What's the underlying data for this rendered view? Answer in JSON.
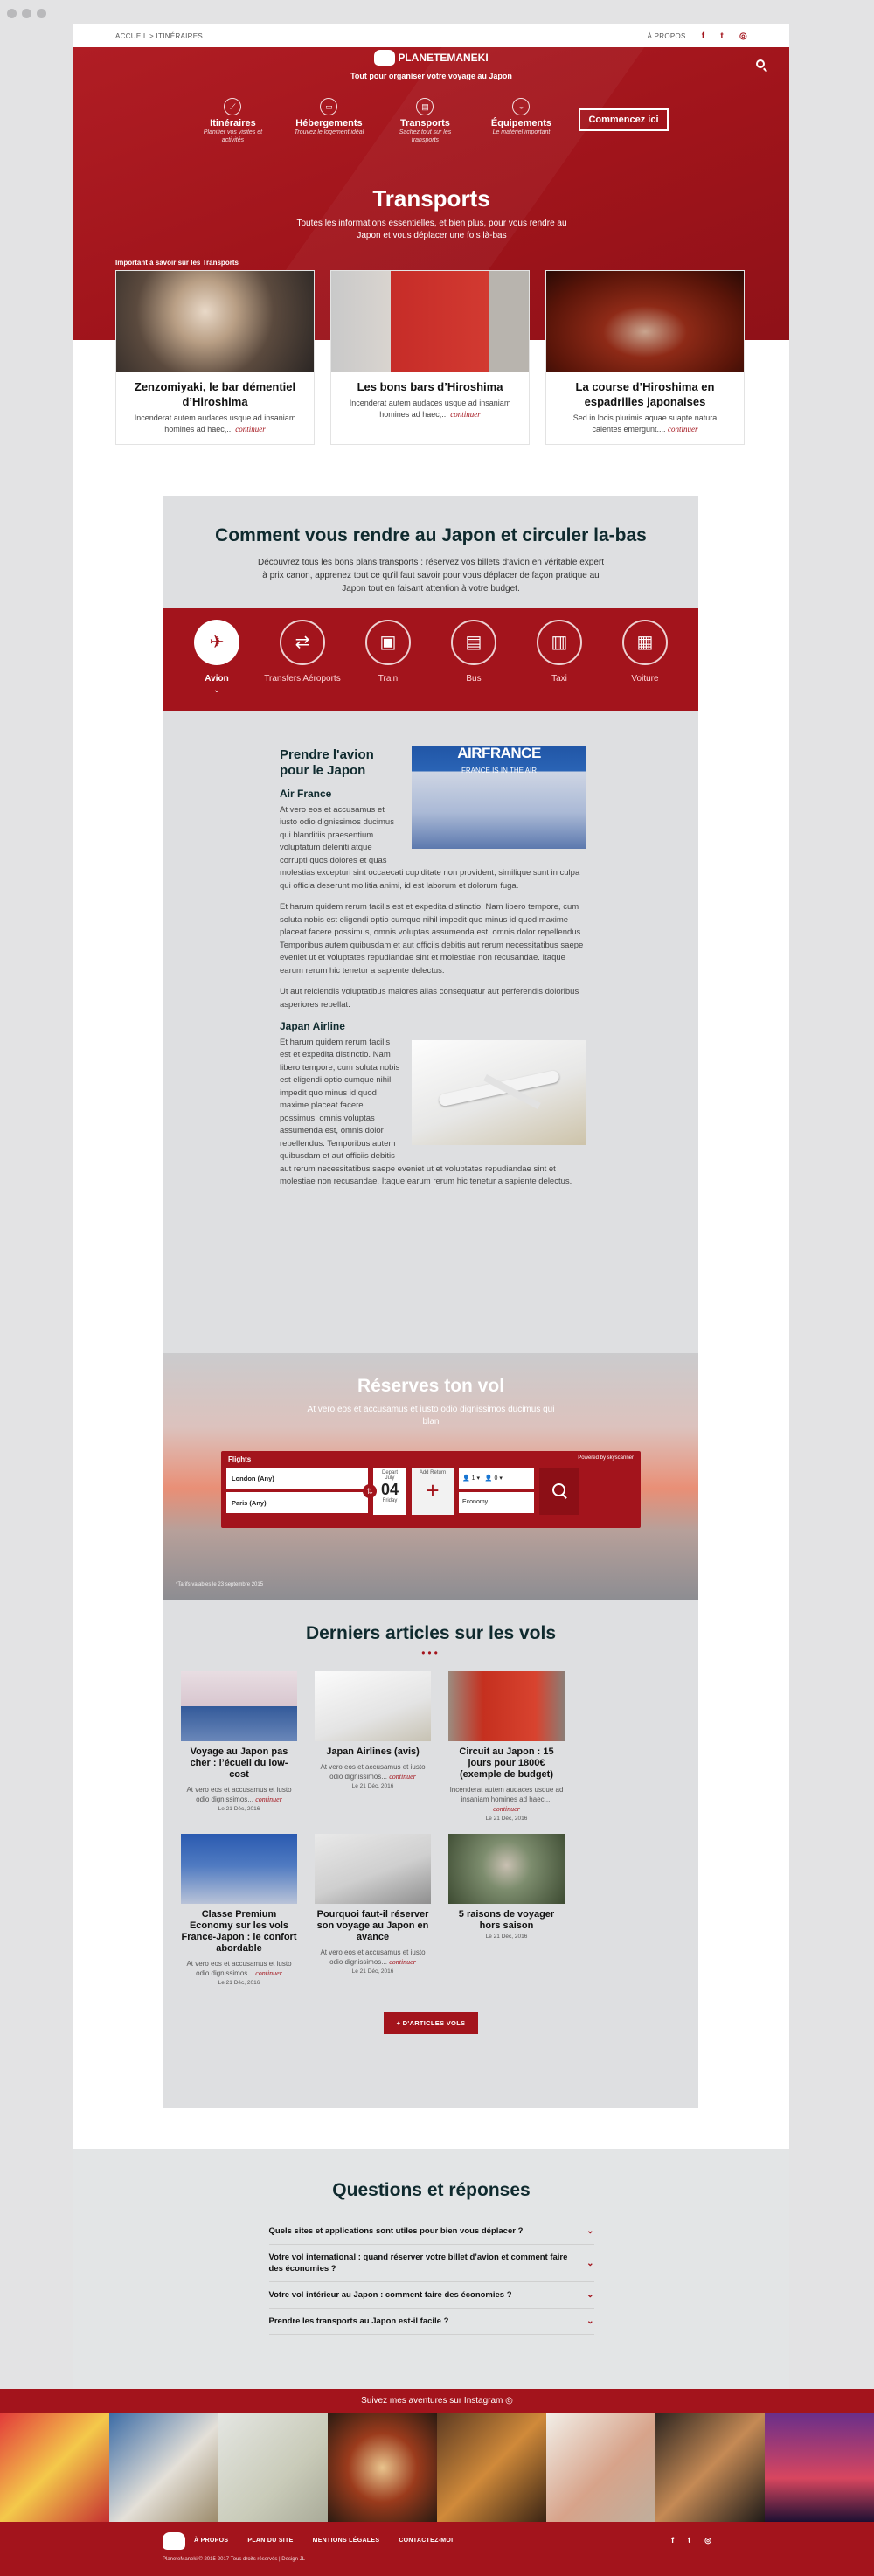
{
  "topbar": {
    "breadcrumb": "ACCUEIL > ITINÉRAIRES",
    "about": "À PROPOS",
    "social": [
      "f",
      "t",
      "◎"
    ]
  },
  "header": {
    "logo_text": "PLANETEMANEKI",
    "tagline": "Tout pour organiser votre voyage au Japon",
    "nav": [
      {
        "title": "Itinéraires",
        "sub": "Planifier vos visites et activités",
        "icon": "route-icon",
        "glyph": "⟋"
      },
      {
        "title": "Hébergements",
        "sub": "Trouvez le logement idéal",
        "icon": "bed-icon",
        "glyph": "▭"
      },
      {
        "title": "Transports",
        "sub": "Sachez tout sur les transports",
        "icon": "train-icon",
        "glyph": "▤"
      },
      {
        "title": "Équipements",
        "sub": "Le matériel important",
        "icon": "backpack-icon",
        "glyph": "◒"
      }
    ],
    "cta": "Commencez ici"
  },
  "hero": {
    "title": "Transports",
    "lead": "Toutes les informations essentielles, et bien plus, pour vous rendre au Japon et vous déplacer une fois là-bas",
    "important": "Important à savoir sur les Transports"
  },
  "cards": [
    {
      "title": "Zenzomiyaki, le bar démentiel d’Hiroshima",
      "text": "Incenderat autem audaces usque ad insaniam homines ad haec,...",
      "more": "continuer"
    },
    {
      "title": "Les bons bars d’Hiroshima",
      "text": "Incenderat autem audaces usque ad insaniam homines ad haec,...",
      "more": "continuer"
    },
    {
      "title": "La course d’Hiroshima en espadrilles japonaises",
      "text": "Sed in locis plurimis aquae suapte natura calentes emergunt....",
      "more": "continuer"
    }
  ],
  "section": {
    "title": "Comment vous rendre au Japon et circuler la-bas",
    "lead": "Découvrez tous les bons plans transports : réservez vos billets d'avion en véritable expert à prix canon, apprenez tout ce qu'il faut savoir pour vous déplacer de façon pratique au Japon tout en faisant attention à votre budget."
  },
  "tabs": [
    {
      "label": "Avion",
      "icon": "plane-icon",
      "glyph": "✈"
    },
    {
      "label": "Transfers Aéroports",
      "icon": "airport-transfer-icon",
      "glyph": "⇄"
    },
    {
      "label": "Train",
      "icon": "train-icon",
      "glyph": "▣"
    },
    {
      "label": "Bus",
      "icon": "bus-icon",
      "glyph": "▤"
    },
    {
      "label": "Taxi",
      "icon": "taxi-icon",
      "glyph": "▥"
    },
    {
      "label": "Voiture",
      "icon": "car-icon",
      "glyph": "▦"
    }
  ],
  "article": {
    "title": "Prendre l'avion pour le Japon",
    "af_title": "Air France",
    "af_img": {
      "brand": "AIRFRANCE",
      "slogan": "FRANCE IS IN THE AIR"
    },
    "af_p1": "At vero eos et accusamus et iusto odio dignissimos ducimus qui blanditiis praesentium voluptatum deleniti atque corrupti quos dolores et quas molestias excepturi sint occaecati cupiditate non provident, similique sunt in culpa qui officia deserunt mollitia animi, id est laborum et dolorum fuga.",
    "af_p2": "Et harum quidem rerum facilis est et expedita distinctio. Nam libero tempore, cum soluta nobis est eligendi optio cumque nihil impedit quo minus id quod maxime placeat facere possimus, omnis voluptas assumenda est, omnis dolor repellendus. Temporibus autem quibusdam et aut officiis debitis aut rerum necessitatibus saepe eveniet ut et voluptates repudiandae sint et molestiae non recusandae. Itaque earum rerum hic tenetur a sapiente delectus.",
    "af_p3": "Ut aut reiciendis voluptatibus maiores alias consequatur aut perferendis doloribus asperiores repellat.",
    "jal_title": "Japan Airline",
    "jal_p1": "Et harum quidem rerum facilis est et expedita distinctio. Nam libero tempore, cum soluta nobis est eligendi optio cumque nihil impedit quo minus id quod maxime placeat facere possimus, omnis voluptas assumenda est, omnis dolor repellendus. Temporibus autem quibusdam et aut officiis debitis aut rerum necessitatibus saepe eveniet ut et voluptates repudiandae sint et molestiae non recusandae. Itaque earum rerum hic tenetur a sapiente delectus."
  },
  "flights": {
    "title": "Réserves ton vol",
    "sub": "At vero eos et accusamus et iusto odio dignissimos ducimus qui blan",
    "widget": {
      "label": "Flights",
      "powered": "Powered by skyscanner",
      "from": "London (Any)",
      "to": "Paris (Any)",
      "depart_label": "Depart",
      "month": "July",
      "day": "04",
      "weekday": "Friday",
      "add_return": "Add Return",
      "plus": "+",
      "adults": "1",
      "children": "0",
      "cabin": "Economy"
    },
    "note": "*Tarifs valables le 23 septembre 2015"
  },
  "latest": {
    "title": "Derniers articles sur les vols",
    "dots": "•••",
    "button": "+ D'ARTICLES VOLS",
    "posts": [
      {
        "title": "Voyage au Japon pas cher : l’écueil du low-cost",
        "text": "At vero eos et accusamus et iusto odio dignissimos...",
        "more": "continuer",
        "date": "Le 21 Déc, 2016"
      },
      {
        "title": "Japan Airlines (avis)",
        "text": "At vero eos et accusamus et iusto odio dignissimos...",
        "more": "continuer",
        "date": "Le 21 Déc, 2016"
      },
      {
        "title": "Circuit au Japon : 15 jours pour 1800€ (exemple de budget)",
        "text": "Incenderat autem audaces usque ad insaniam homines ad haec,...",
        "more": "continuer",
        "date": "Le 21 Déc, 2016"
      },
      {
        "title": "Classe Premium Economy sur les vols France-Japon : le confort abordable",
        "text": "At vero eos et accusamus et iusto odio dignissimos...",
        "more": "continuer",
        "date": "Le 21 Déc, 2016"
      },
      {
        "title": "Pourquoi faut-il réserver son voyage au Japon en avance",
        "text": "At vero eos et accusamus et iusto odio dignissimos...",
        "more": "continuer",
        "date": "Le 21 Déc, 2016"
      },
      {
        "title": "5 raisons de voyager hors saison",
        "text": "",
        "more": "",
        "date": "Le 21 Déc, 2016"
      }
    ]
  },
  "faq": {
    "title": "Questions et réponses",
    "items": [
      "Quels sites et applications sont utiles pour bien vous déplacer ?",
      "Votre vol international : quand réserver votre billet d’avion et comment faire des économies ?",
      "Votre vol intérieur au Japon : comment faire des économies ?",
      "Prendre les transports au Japon est-il facile ?"
    ]
  },
  "instagram": {
    "label": "Suivez mes aventures sur Instagram ◎"
  },
  "footer": {
    "links": [
      "À PROPOS",
      "PLAN DU SITE",
      "MENTIONS LÉGALES",
      "CONTACTEZ-MOI"
    ],
    "social": [
      "f",
      "t",
      "◎"
    ],
    "copy": "PlaneteManeki © 2015-2017 Tous droits réservés | Design JL"
  },
  "colors": {
    "brand": "#a3141c",
    "panel": "#dedfe1",
    "heading": "#0f2a2e"
  }
}
